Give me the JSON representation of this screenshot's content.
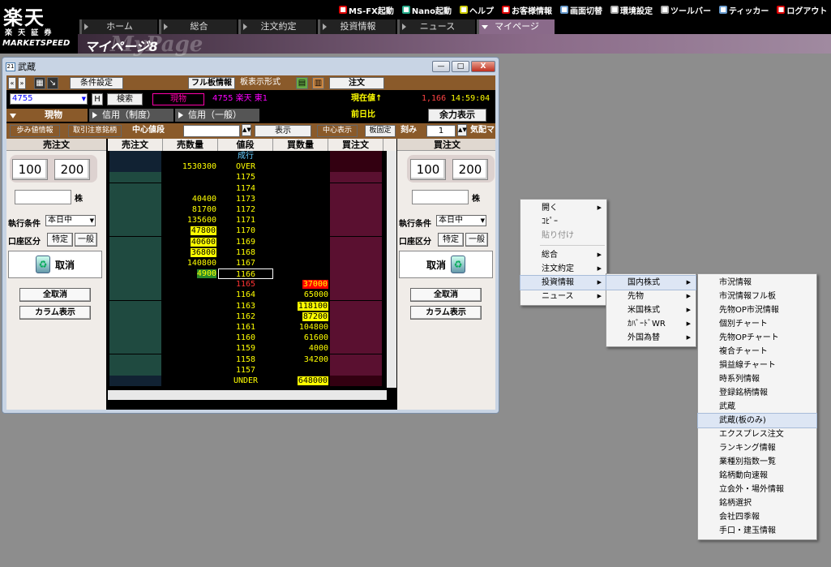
{
  "logo": {
    "kanji": "楽天",
    "sub": "楽 天 証 券",
    "product": "MARKETSPEED"
  },
  "toolmenu": [
    {
      "label": "MS-FX起動",
      "icon": "fx-icon",
      "color": "#d00"
    },
    {
      "label": "Nano起動",
      "icon": "nano-icon",
      "color": "#2a8"
    },
    {
      "label": "ヘルプ",
      "icon": "help-icon",
      "color": "#cc0"
    },
    {
      "label": "お客様情報",
      "icon": "customer-icon",
      "color": "#d00"
    },
    {
      "label": "画面切替",
      "icon": "screen-switch-icon",
      "color": "#69c"
    },
    {
      "label": "環境設定",
      "icon": "settings-icon",
      "color": "#aaa"
    },
    {
      "label": "ツールバー",
      "icon": "toolbar-icon",
      "color": "#aaa"
    },
    {
      "label": "ティッカー",
      "icon": "ticker-icon",
      "color": "#69c"
    },
    {
      "label": "ログアウト",
      "icon": "logout-icon",
      "color": "#d00"
    }
  ],
  "navtabs": [
    "ホーム",
    "総合",
    "注文約定",
    "投資情報",
    "ニュース",
    "マイページ"
  ],
  "mypage": {
    "title": "マイページ8",
    "watermark": "MyPage"
  },
  "window": {
    "title": "武蔵",
    "min": "—",
    "max": "□",
    "close": "X"
  },
  "toolbar": {
    "condition": "条件設定",
    "full_board": "フル板情報",
    "board_format": "板表示形式",
    "order": "注文"
  },
  "quote": {
    "code": "4755",
    "h": "H",
    "search": "検索",
    "market_type": "現物",
    "stock": "4755 楽天 東1",
    "current_label": "現在値↑",
    "current": "1,166",
    "time": "14:59:04",
    "prev_label": "前日比",
    "remaining": "余力表示"
  },
  "tabs": [
    "現物",
    "信用（制度）",
    "信用（一般）"
  ],
  "row4": {
    "ayumi": "歩み値情報",
    "torihiki": "取引注意銘柄",
    "center_label": "中心値段",
    "display": "表示",
    "center_display": "中心表示",
    "fixed": "板固定",
    "tick_label": "刻み",
    "tick": "1",
    "kehai": "気配マ"
  },
  "sell_panel": {
    "title": "売注文",
    "q1": "100",
    "q2": "200",
    "unit": "株",
    "cond_label": "執行条件",
    "cond": "本日中",
    "acct_label": "口座区分",
    "acct1": "特定",
    "acct2": "一般",
    "cancel": "取消",
    "cancel_all": "全取消",
    "column": "カラム表示"
  },
  "buy_panel": {
    "title": "買注文",
    "q1": "100",
    "q2": "200",
    "unit": "株",
    "cond_label": "執行条件",
    "cond": "本日中",
    "acct_label": "口座区分",
    "acct1": "特定",
    "acct2": "一般",
    "cancel": "取消",
    "cancel_all": "全取消",
    "column": "カラム表示"
  },
  "board_headers": [
    "売注文",
    "売数量",
    "値段",
    "買数量",
    "買注文"
  ],
  "board_rows": [
    {
      "sq": "",
      "pr": "成行",
      "bq": "",
      "prc": "#6cf"
    },
    {
      "sq": "1530300",
      "pr": "OVER",
      "bq": ""
    },
    {
      "sq": "",
      "pr": "1175",
      "bq": ""
    },
    {
      "sq": "",
      "pr": "1174",
      "bq": ""
    },
    {
      "sq": "40400",
      "pr": "1173",
      "bq": ""
    },
    {
      "sq": "81700",
      "pr": "1172",
      "bq": ""
    },
    {
      "sq": "135600",
      "pr": "1171",
      "bq": ""
    },
    {
      "sq": "47800",
      "pr": "1170",
      "bq": "",
      "sqh": true
    },
    {
      "sq": "40600",
      "pr": "1169",
      "bq": "",
      "sqh": true
    },
    {
      "sq": "36800",
      "pr": "1168",
      "bq": "",
      "sqh": true
    },
    {
      "sq": "140800",
      "pr": "1167",
      "bq": ""
    },
    {
      "sq": "4900",
      "pr": "1166",
      "bq": "",
      "sqg": true,
      "box": true
    },
    {
      "sq": "",
      "pr": "1165",
      "bq": "37000",
      "prr": true,
      "bqr": true
    },
    {
      "sq": "",
      "pr": "1164",
      "bq": "65000"
    },
    {
      "sq": "",
      "pr": "1163",
      "bq": "118100",
      "bqh": true
    },
    {
      "sq": "",
      "pr": "1162",
      "bq": "87200",
      "bqh": true
    },
    {
      "sq": "",
      "pr": "1161",
      "bq": "104800"
    },
    {
      "sq": "",
      "pr": "1160",
      "bq": "61600"
    },
    {
      "sq": "",
      "pr": "1159",
      "bq": "4000"
    },
    {
      "sq": "",
      "pr": "1158",
      "bq": "34200"
    },
    {
      "sq": "",
      "pr": "1157",
      "bq": ""
    },
    {
      "sq": "",
      "pr": "UNDER",
      "bq": "648000",
      "bqh": true
    }
  ],
  "menu1": [
    "開く",
    "ｺﾋﾟｰ",
    "貼り付け",
    "総合",
    "注文約定",
    "投資情報",
    "ニュース"
  ],
  "menu2": [
    "国内株式",
    "先物",
    "米国株式",
    "ｶﾊﾞｰﾄﾞWR",
    "外国為替"
  ],
  "menu3": [
    "市況情報",
    "市況情報フル板",
    "先物OP市況情報",
    "個別チャート",
    "先物OPチャート",
    "複合チャート",
    "損益線チャート",
    "時系列情報",
    "登録銘柄情報",
    "武蔵",
    "武蔵(板のみ)",
    "エクスプレス注文",
    "ランキング情報",
    "業種別指数一覧",
    "銘柄動向速報",
    "立会外・場外情報",
    "銘柄選択",
    "会社四季報",
    "手口・建玉情報"
  ]
}
